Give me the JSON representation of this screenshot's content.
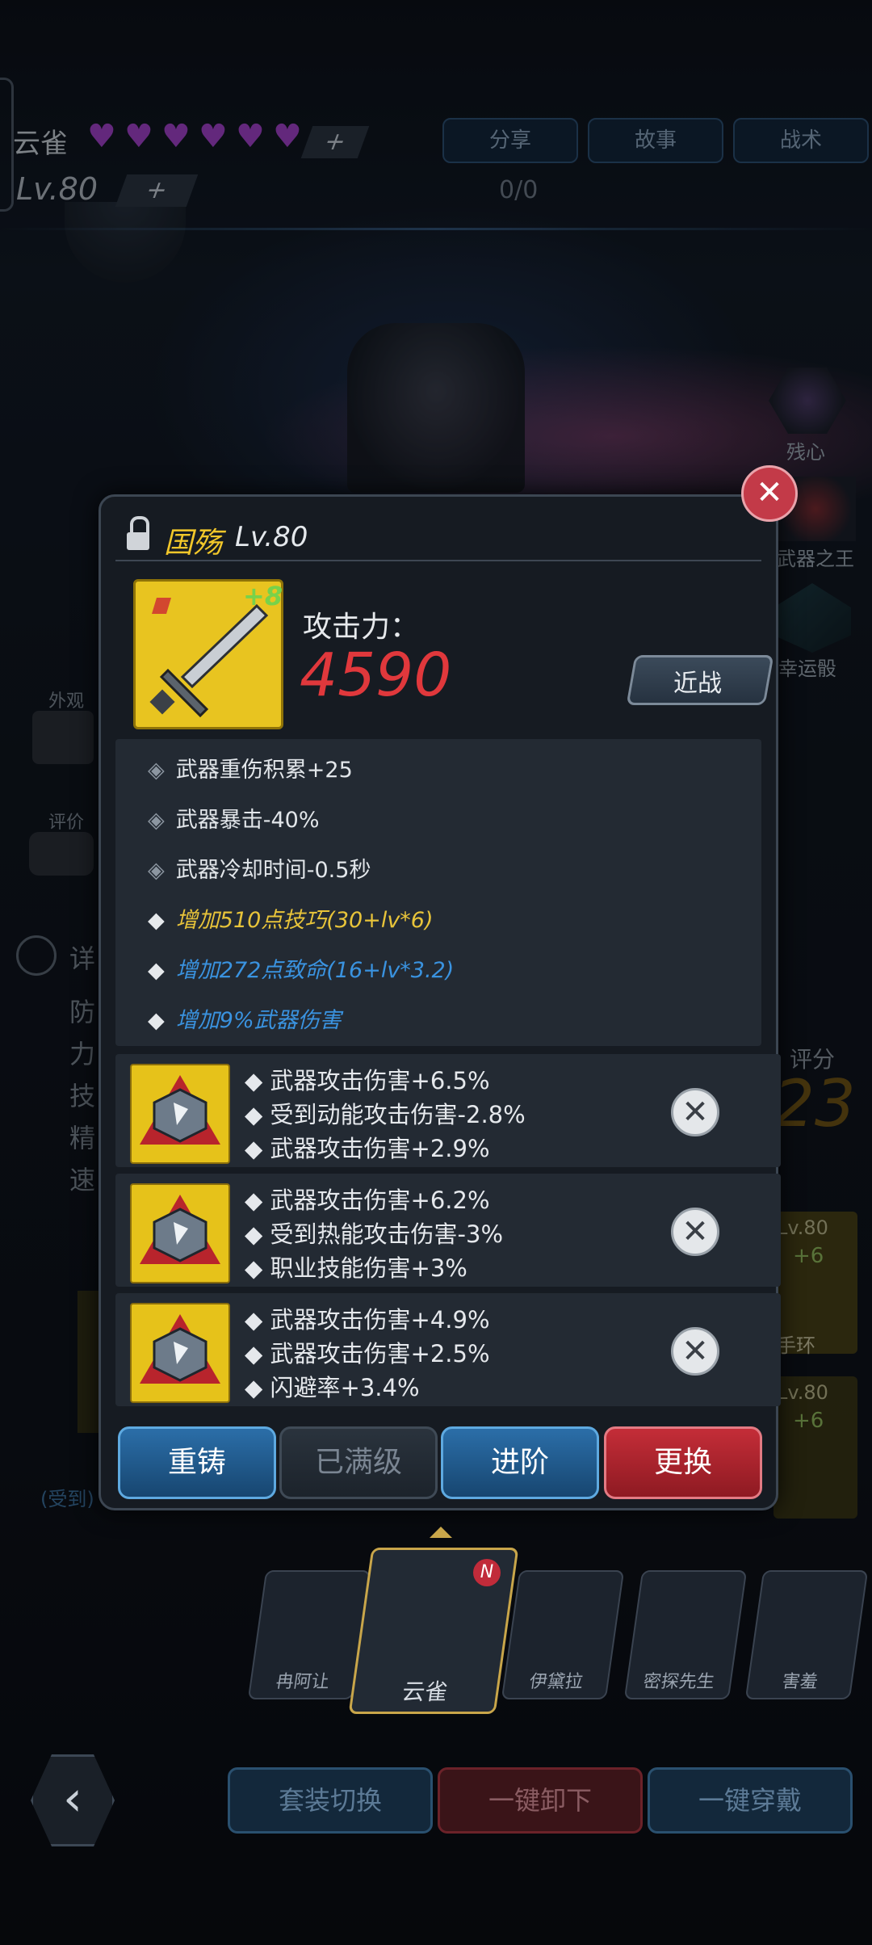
{
  "header": {
    "character_name": "云雀",
    "level": "Lv.80",
    "hearts": 6,
    "progress": "0/0",
    "tabs": [
      "分享",
      "故事",
      "战术"
    ]
  },
  "side_right": [
    "残心",
    "武器之王",
    "幸运骰"
  ],
  "side_left": [
    "外观",
    "评价",
    "详",
    "防",
    "力",
    "技",
    "精",
    "速"
  ],
  "bg_texts": {
    "score_label": "评分",
    "score_value": "23",
    "item_lv1": "Lv.80",
    "item_plus1": "+6",
    "item_name1": "手环",
    "item_lv2": "Lv.80",
    "item_plus2": "+6",
    "damage_hint": "(受到)"
  },
  "modal": {
    "weapon_name": "国殇",
    "weapon_level": "Lv.80",
    "enhance": "+8",
    "attack_label": "攻击力：",
    "attack_value": "4590",
    "weapon_type": "近战",
    "attributes": [
      {
        "text": "武器重伤积累+25",
        "color": "#e2e6ea"
      },
      {
        "text": "武器暴击-40%",
        "color": "#e2e6ea"
      },
      {
        "text": "武器冷却时间-0.5秒",
        "color": "#e2e6ea"
      },
      {
        "text": "增加510点技巧(30+lv*6)",
        "color": "#e8c43a"
      },
      {
        "text": "增加272点致命(16+lv*3.2)",
        "color": "#3a93e0"
      },
      {
        "text": "增加9%武器伤害",
        "color": "#3a93e0"
      }
    ],
    "gems": [
      {
        "lines": [
          "武器攻击伤害+6.5%",
          "受到动能攻击伤害-2.8%",
          "武器攻击伤害+2.9%"
        ]
      },
      {
        "lines": [
          "武器攻击伤害+6.2%",
          "受到热能攻击伤害-3%",
          "职业技能伤害+3%"
        ]
      },
      {
        "lines": [
          "武器攻击伤害+4.9%",
          "武器攻击伤害+2.5%",
          "闪避率+3.4%"
        ]
      }
    ],
    "actions": {
      "recast": "重铸",
      "maxed": "已满级",
      "advance": "进阶",
      "replace": "更换"
    }
  },
  "heroes": [
    "冉阿让",
    "云雀",
    "伊黛拉",
    "密探先生",
    "害羞"
  ],
  "bottom": {
    "suit_switch": "套装切换",
    "unequip_all": "一键卸下",
    "equip_all": "一键穿戴"
  },
  "colors": {
    "accent_yellow": "#f2c72a",
    "attack_red": "#e0383c",
    "replace_red": "#b8222c",
    "blue_button": "#1f5f96"
  }
}
